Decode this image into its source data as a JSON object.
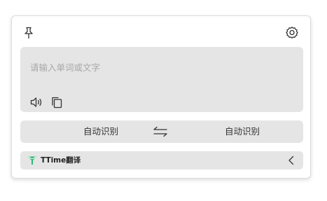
{
  "toolbar": {
    "pin_icon": "pin-icon",
    "settings_icon": "gear-icon"
  },
  "input": {
    "placeholder": "请输入单词或文字",
    "value": "",
    "speak_icon": "speaker-icon",
    "copy_icon": "copy-icon"
  },
  "languages": {
    "from": "自动识别",
    "to": "自动识别",
    "swap_icon": "swap-arrows-icon"
  },
  "service": {
    "name": "TTime翻译",
    "logo_icon": "ttime-logo-icon",
    "logo_color": "#2bb673",
    "collapse_icon": "chevron-left-icon"
  },
  "colors": {
    "panel_bg": "#e5e5e5",
    "window_bg": "#ffffff",
    "icon": "#333333",
    "placeholder": "#a8a8a8"
  }
}
